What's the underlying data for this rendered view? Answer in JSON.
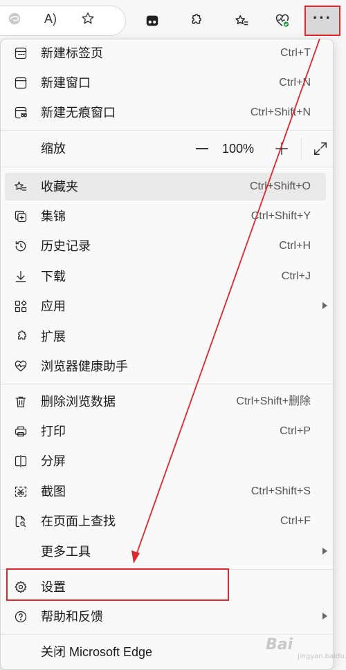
{
  "toolbar": {
    "icons": [
      "edge-icon",
      "read-aloud-icon",
      "favorite-star-icon",
      "tab-icon",
      "extensions-icon",
      "favorites-icon",
      "browser-health-icon",
      "more-icon"
    ],
    "read_aloud_label": "A)",
    "more_label": "···"
  },
  "menu": {
    "items": [
      {
        "id": "new-tab",
        "label": "新建标签页",
        "shortcut": "Ctrl+T",
        "icon": "new-tab-icon"
      },
      {
        "id": "new-window",
        "label": "新建窗口",
        "shortcut": "Ctrl+N",
        "icon": "new-window-icon"
      },
      {
        "id": "new-inprivate",
        "label": "新建无痕窗口",
        "shortcut": "Ctrl+Shift+N",
        "icon": "inprivate-icon"
      },
      {
        "id": "zoom",
        "label": "缩放",
        "value": "100%"
      },
      {
        "id": "favorites",
        "label": "收藏夹",
        "shortcut": "Ctrl+Shift+O",
        "icon": "favorites-icon"
      },
      {
        "id": "collections",
        "label": "集锦",
        "shortcut": "Ctrl+Shift+Y",
        "icon": "collections-icon"
      },
      {
        "id": "history",
        "label": "历史记录",
        "shortcut": "Ctrl+H",
        "icon": "history-icon"
      },
      {
        "id": "downloads",
        "label": "下载",
        "shortcut": "Ctrl+J",
        "icon": "download-icon"
      },
      {
        "id": "apps",
        "label": "应用",
        "icon": "apps-icon"
      },
      {
        "id": "extensions",
        "label": "扩展",
        "icon": "extensions-icon"
      },
      {
        "id": "browser-health",
        "label": "浏览器健康助手",
        "icon": "browser-health-icon"
      },
      {
        "id": "clear-data",
        "label": "删除浏览数据",
        "shortcut": "Ctrl+Shift+删除",
        "icon": "trash-icon"
      },
      {
        "id": "print",
        "label": "打印",
        "shortcut": "Ctrl+P",
        "icon": "print-icon"
      },
      {
        "id": "split-screen",
        "label": "分屏",
        "icon": "split-screen-icon"
      },
      {
        "id": "screenshot",
        "label": "截图",
        "shortcut": "Ctrl+Shift+S",
        "icon": "screenshot-icon"
      },
      {
        "id": "find",
        "label": "在页面上查找",
        "shortcut": "Ctrl+F",
        "icon": "find-icon"
      },
      {
        "id": "more-tools",
        "label": "更多工具"
      },
      {
        "id": "settings",
        "label": "设置",
        "icon": "gear-icon"
      },
      {
        "id": "help",
        "label": "帮助和反馈",
        "icon": "help-icon"
      },
      {
        "id": "close",
        "label": "关闭 Microsoft Edge"
      }
    ]
  },
  "colors": {
    "highlight_red": "#e0252b",
    "menu_bg": "#f9f9f9",
    "hover_bg": "#e9e9e9",
    "health_badge": "#1a9e3f"
  },
  "watermark": {
    "text": "Bai",
    "sub": "jingyan.baidu.com"
  }
}
